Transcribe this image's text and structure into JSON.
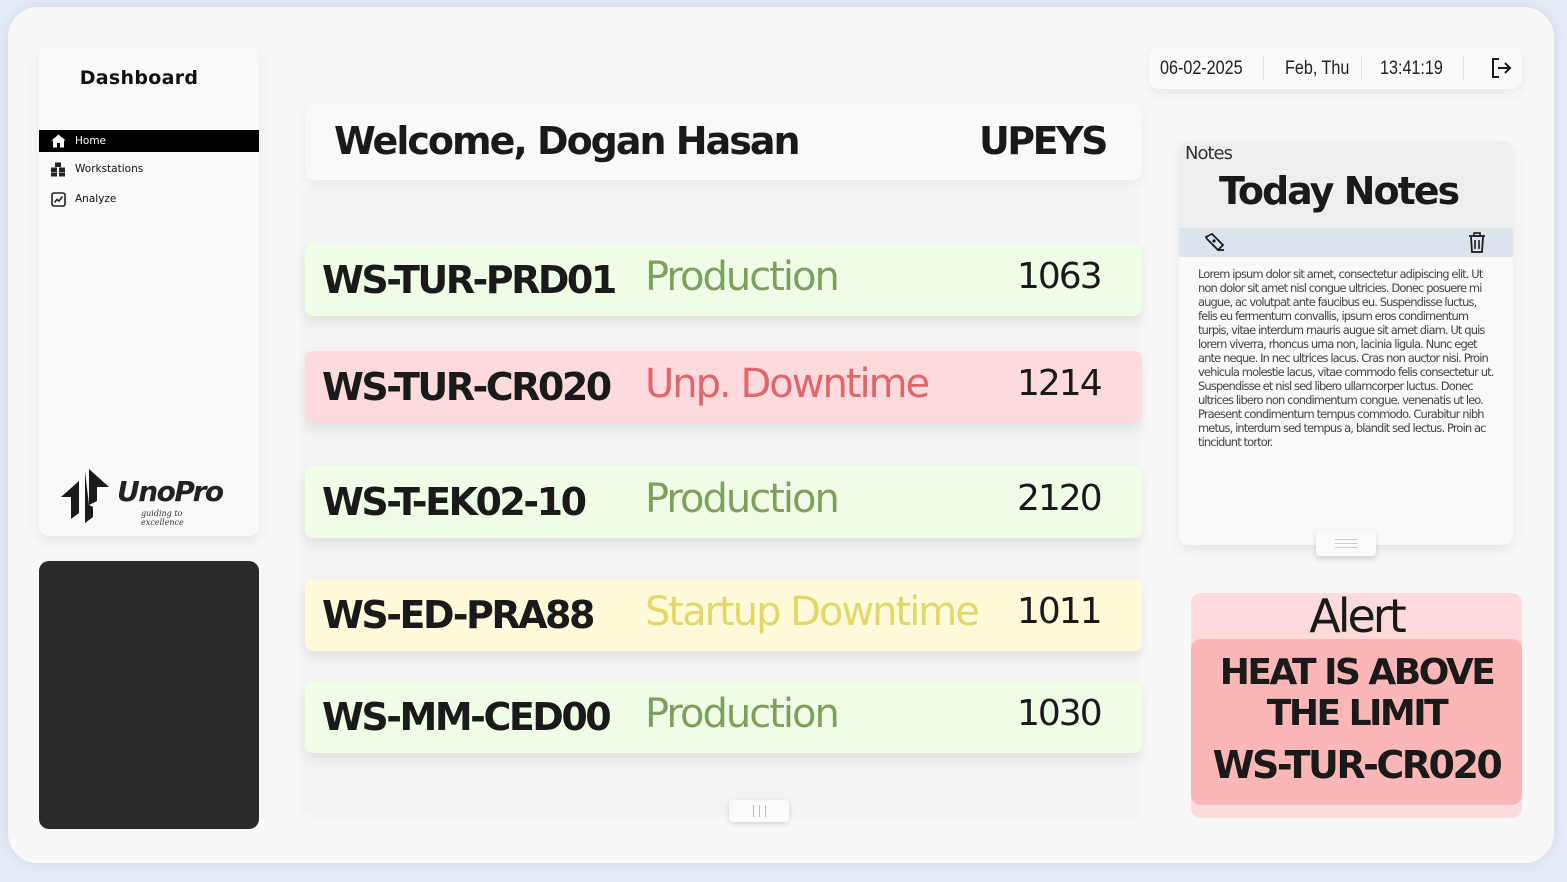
{
  "sidebar": {
    "title": "Dashboard",
    "items": [
      {
        "label": "Home",
        "icon": "home-icon",
        "active": true
      },
      {
        "label": "Workstations",
        "icon": "workstations-icon",
        "active": false
      },
      {
        "label": "Analyze",
        "icon": "chart-icon",
        "active": false
      }
    ],
    "logo": {
      "name": "UnoPro",
      "tagline": "guiding to excellence"
    }
  },
  "header": {
    "welcome": "Welcome, Dogan Hasan",
    "brand": "UPEYS"
  },
  "workstations": [
    {
      "id": "WS-TUR-PRD01",
      "status": "Production",
      "value": "1063",
      "kind": "production"
    },
    {
      "id": "WS-TUR-CR020",
      "status": "Unp. Downtime",
      "value": "1214",
      "kind": "downtime"
    },
    {
      "id": "WS-T-EK02-10",
      "status": "Production",
      "value": "2120",
      "kind": "production"
    },
    {
      "id": "WS-ED-PRA88",
      "status": "Startup Downtime",
      "value": "1011",
      "kind": "startup"
    },
    {
      "id": "WS-MM-CED00",
      "status": "Production",
      "value": "1030",
      "kind": "production"
    }
  ],
  "datebar": {
    "date": "06-02-2025",
    "day": "Feb, Thu",
    "time": "13:41:19",
    "logout_icon": "logout-icon"
  },
  "notes": {
    "small_label": "Notes",
    "title": "Today Notes",
    "edit_icon": "pen-icon",
    "delete_icon": "trash-icon",
    "body": "Lorem ipsum dolor sit amet, consectetur adipiscing elit. Ut non dolor  sit amet nisl congue ultricies. Donec posuere mi augue, ac volutpat ante faucibus eu. Suspendisse luctus, felis eu fermentum convallis, ipsum  eros condimentum turpis, vitae interdum mauris augue sit amet diam. Ut  quis lorem viverra, rhoncus urna non, lacinia ligula. Nunc eget ante neque. In nec ultrices lacus. Cras non auctor nisi. Proin vehicula  molestie lacus, vitae commodo felis consectetur ut. Suspendisse et nisl  sed libero ullamcorper luctus. Donec ultrices libero non condimentum  congue. venenatis ut leo. Praesent condimentum tempus commodo. Curabitur nibh metus, interdum sed tempus a, blandit sed lectus. Proin ac tincidunt  tortor."
  },
  "alert": {
    "title": "Alert",
    "message": "HEAT IS ABOVE THE LIMIT",
    "workstation": "WS-TUR-CR020"
  },
  "colors": {
    "production_bg": "#effde6",
    "production_text": "#7fa05c",
    "downtime_bg": "#fddbdc",
    "downtime_text": "#e0666b",
    "startup_bg": "#fffad9",
    "startup_text": "#e3d768",
    "alert_bg": "#fbb7b8"
  }
}
